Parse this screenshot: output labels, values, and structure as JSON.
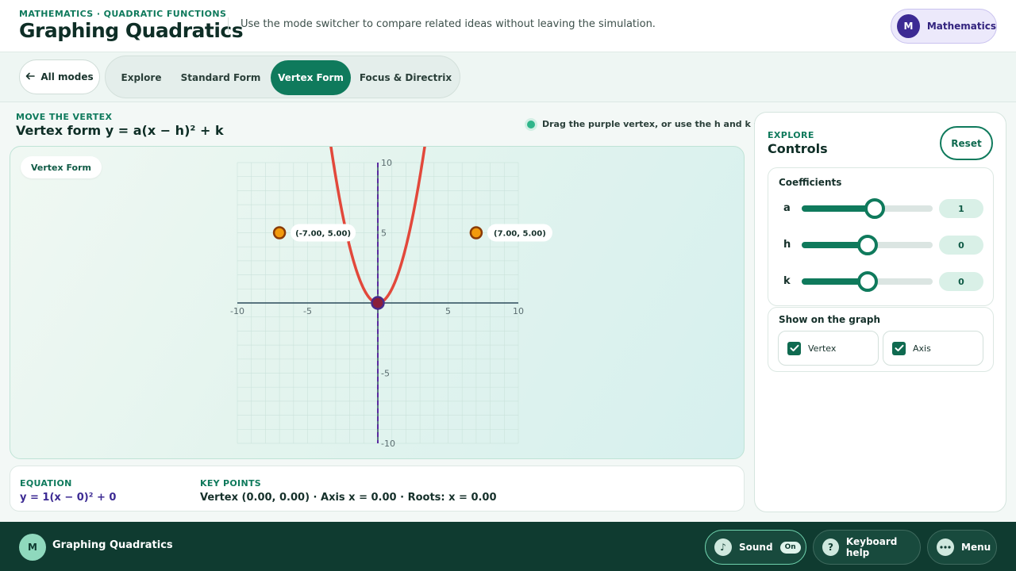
{
  "header": {
    "eyebrow": "MATHEMATICS · QUADRATIC FUNCTIONS",
    "title": "Graphing Quadratics",
    "hint": "Use the mode switcher to compare related ideas without leaving the simulation.",
    "subject": {
      "avatar": "M",
      "name": "Mathematics"
    }
  },
  "modebar": {
    "all_modes": "All modes",
    "tabs": [
      {
        "label": "Explore",
        "active": false
      },
      {
        "label": "Standard Form",
        "active": false
      },
      {
        "label": "Vertex Form",
        "active": true
      },
      {
        "label": "Focus & Directrix",
        "active": false
      }
    ]
  },
  "main": {
    "kicker": "MOVE THE VERTEX",
    "title": "Vertex form y = a(x − h)² + k",
    "hint": "Drag the purple vertex, or use the h and k sliders.",
    "graph_badge": "Vertex Form",
    "equation_label": "EQUATION",
    "equation_value": "y = 1(x − 0)² + 0",
    "keypoints_label": "KEY POINTS",
    "keypoints_value": "Vertex (0.00, 0.00) · Axis x = 0.00 · Roots: x = 0.00"
  },
  "graph": {
    "x_range": [
      -10,
      10
    ],
    "y_range": [
      -10,
      10
    ],
    "x_ticks": [
      "-10",
      "-5",
      "5",
      "10"
    ],
    "y_ticks": [
      "10",
      "5",
      "-5",
      "-10"
    ],
    "parabola": {
      "a": 1,
      "h": 0,
      "k": 0
    },
    "vertex": {
      "x": 0,
      "y": 0
    },
    "axis_of_symmetry": 0,
    "points": [
      {
        "x": -7,
        "y": 5,
        "label": "(-7.00, 5.00)"
      },
      {
        "x": 7,
        "y": 5,
        "label": "(7.00, 5.00)"
      }
    ],
    "colors": {
      "curve": "#e2483b",
      "vertex": "#8a1f3a",
      "axis": "#5a2ba0",
      "point": "#f29a0c"
    }
  },
  "controls": {
    "kicker": "EXPLORE",
    "title": "Controls",
    "reset": "Reset",
    "coefficients_title": "Coefficients",
    "sliders": [
      {
        "label": "a",
        "value": "1",
        "level": 0.56
      },
      {
        "label": "h",
        "value": "0",
        "level": 0.5
      },
      {
        "label": "k",
        "value": "0",
        "level": 0.5
      }
    ],
    "show_title": "Show on the graph",
    "checks": [
      {
        "label": "Vertex",
        "checked": true
      },
      {
        "label": "Axis",
        "checked": true
      }
    ]
  },
  "bottombar": {
    "avatar": "M",
    "title": "Graphing Quadratics",
    "sound_label": "Sound",
    "sound_state": "On",
    "keyboard_label": "Keyboard help",
    "menu_label": "Menu"
  },
  "colors": {
    "brand": "#0f7a5c",
    "bottombar": "#0f3b30",
    "subject": "#3c2a93"
  }
}
